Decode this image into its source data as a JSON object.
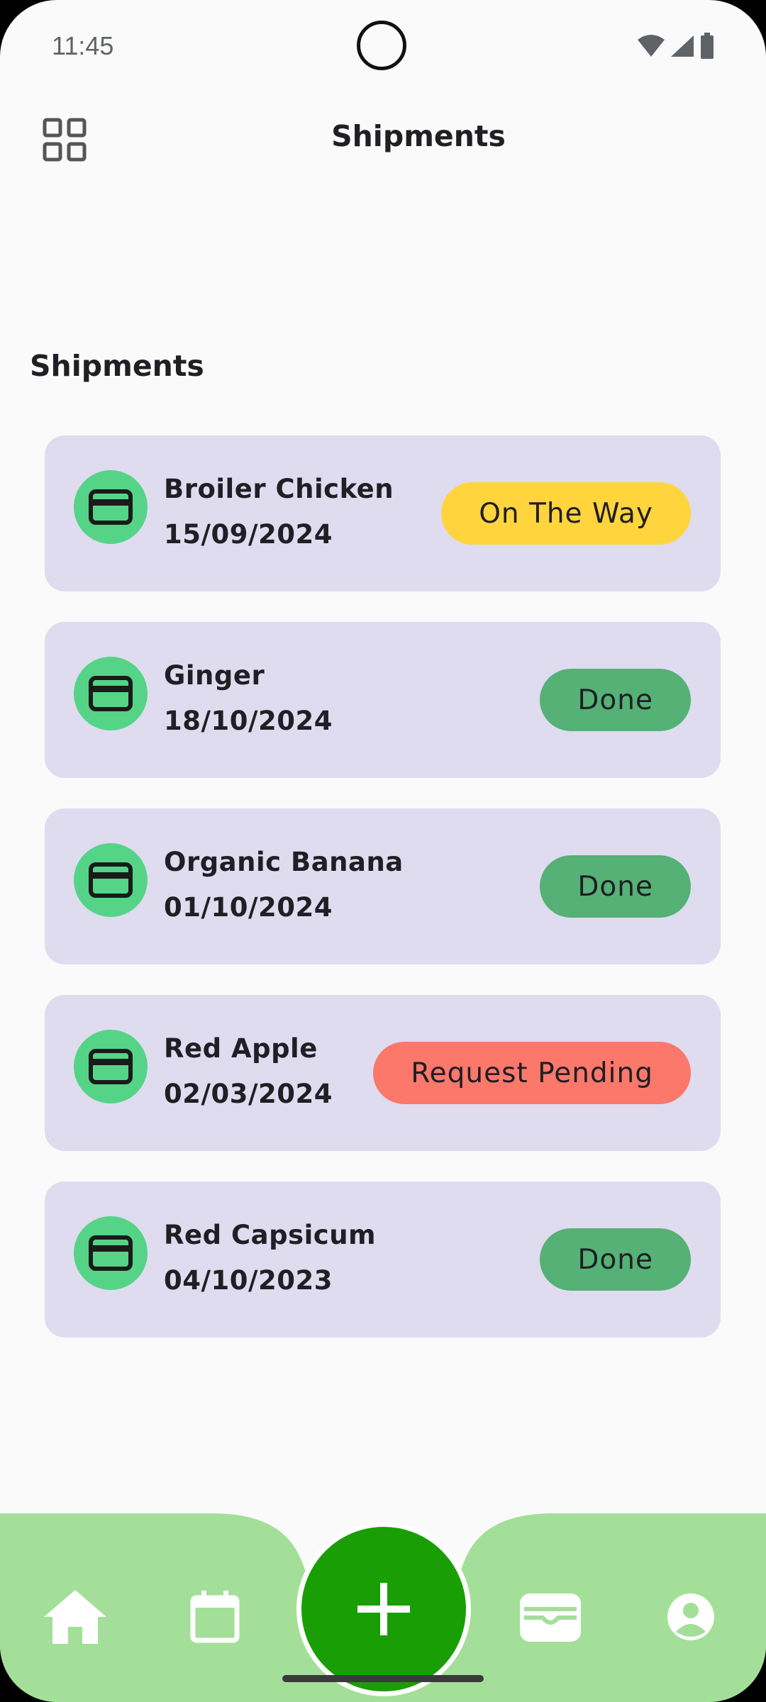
{
  "status_bar": {
    "time": "11:45",
    "icons": [
      "wifi-icon",
      "signal-icon",
      "battery-icon"
    ]
  },
  "app_bar": {
    "title": "Shipments",
    "menu_icon": "grid-icon"
  },
  "section": {
    "title": "Shipments"
  },
  "shipments": [
    {
      "name": "Broiler Chicken",
      "date": "15/09/2024",
      "status": "On The Way",
      "status_color": "#ffd43d",
      "icon": "card-icon"
    },
    {
      "name": "Ginger",
      "date": "18/10/2024",
      "status": "Done",
      "status_color": "#55b175",
      "icon": "card-icon"
    },
    {
      "name": "Organic Banana",
      "date": "01/10/2024",
      "status": "Done",
      "status_color": "#55b175",
      "icon": "card-icon"
    },
    {
      "name": "Red Apple",
      "date": "02/03/2024",
      "status": "Request Pending",
      "status_color": "#fb786b",
      "icon": "card-icon"
    },
    {
      "name": "Red Capsicum",
      "date": "04/10/2023",
      "status": "Done",
      "status_color": "#55b175",
      "icon": "card-icon"
    }
  ],
  "bottom_nav": {
    "items": [
      "home-icon",
      "calendar-icon",
      "add-icon",
      "wallet-icon",
      "profile-icon"
    ],
    "background_color": "#a3df98",
    "fab_color": "#1a9e05"
  },
  "colors": {
    "card_background": "#dfdcf0",
    "icon_circle": "#55d487",
    "screen_background": "#fafafa"
  }
}
